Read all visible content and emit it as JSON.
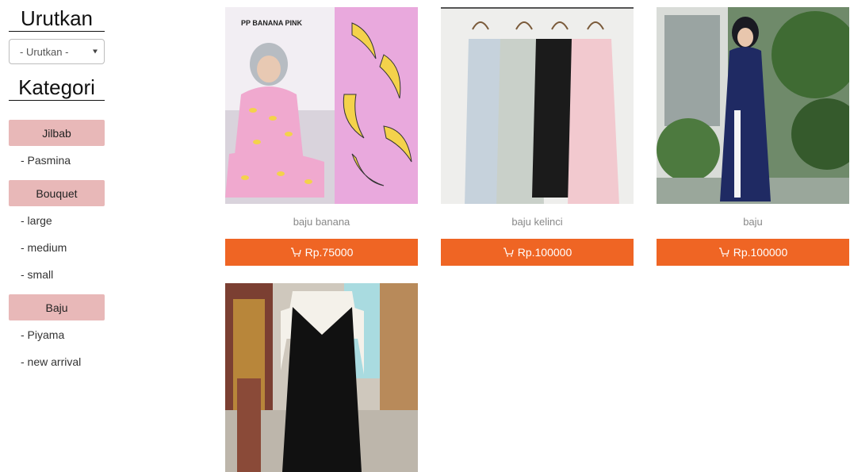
{
  "sidebar": {
    "sort_heading": "Urutkan",
    "sort_select": {
      "selected": "- Urutkan -"
    },
    "category_heading": "Kategori",
    "categories": [
      {
        "label": "Jilbab",
        "subs": [
          "- Pasmina"
        ]
      },
      {
        "label": "Bouquet",
        "subs": [
          "- large",
          "- medium",
          "- small"
        ]
      },
      {
        "label": "Baju",
        "subs": [
          "- Piyama",
          "- new arrival"
        ]
      }
    ]
  },
  "products": [
    {
      "name": "baju banana",
      "price": "Rp.75000",
      "image_text": "PP BANANA PINK"
    },
    {
      "name": "baju kelinci",
      "price": "Rp.100000"
    },
    {
      "name": "baju",
      "price": "Rp.100000"
    },
    {
      "name": "",
      "price": ""
    }
  ],
  "colors": {
    "accent_orange": "#ef6524",
    "category_pink": "#e8b8b8"
  },
  "icons": {
    "cart": "cart-icon",
    "caret": "chevron-down-icon"
  }
}
